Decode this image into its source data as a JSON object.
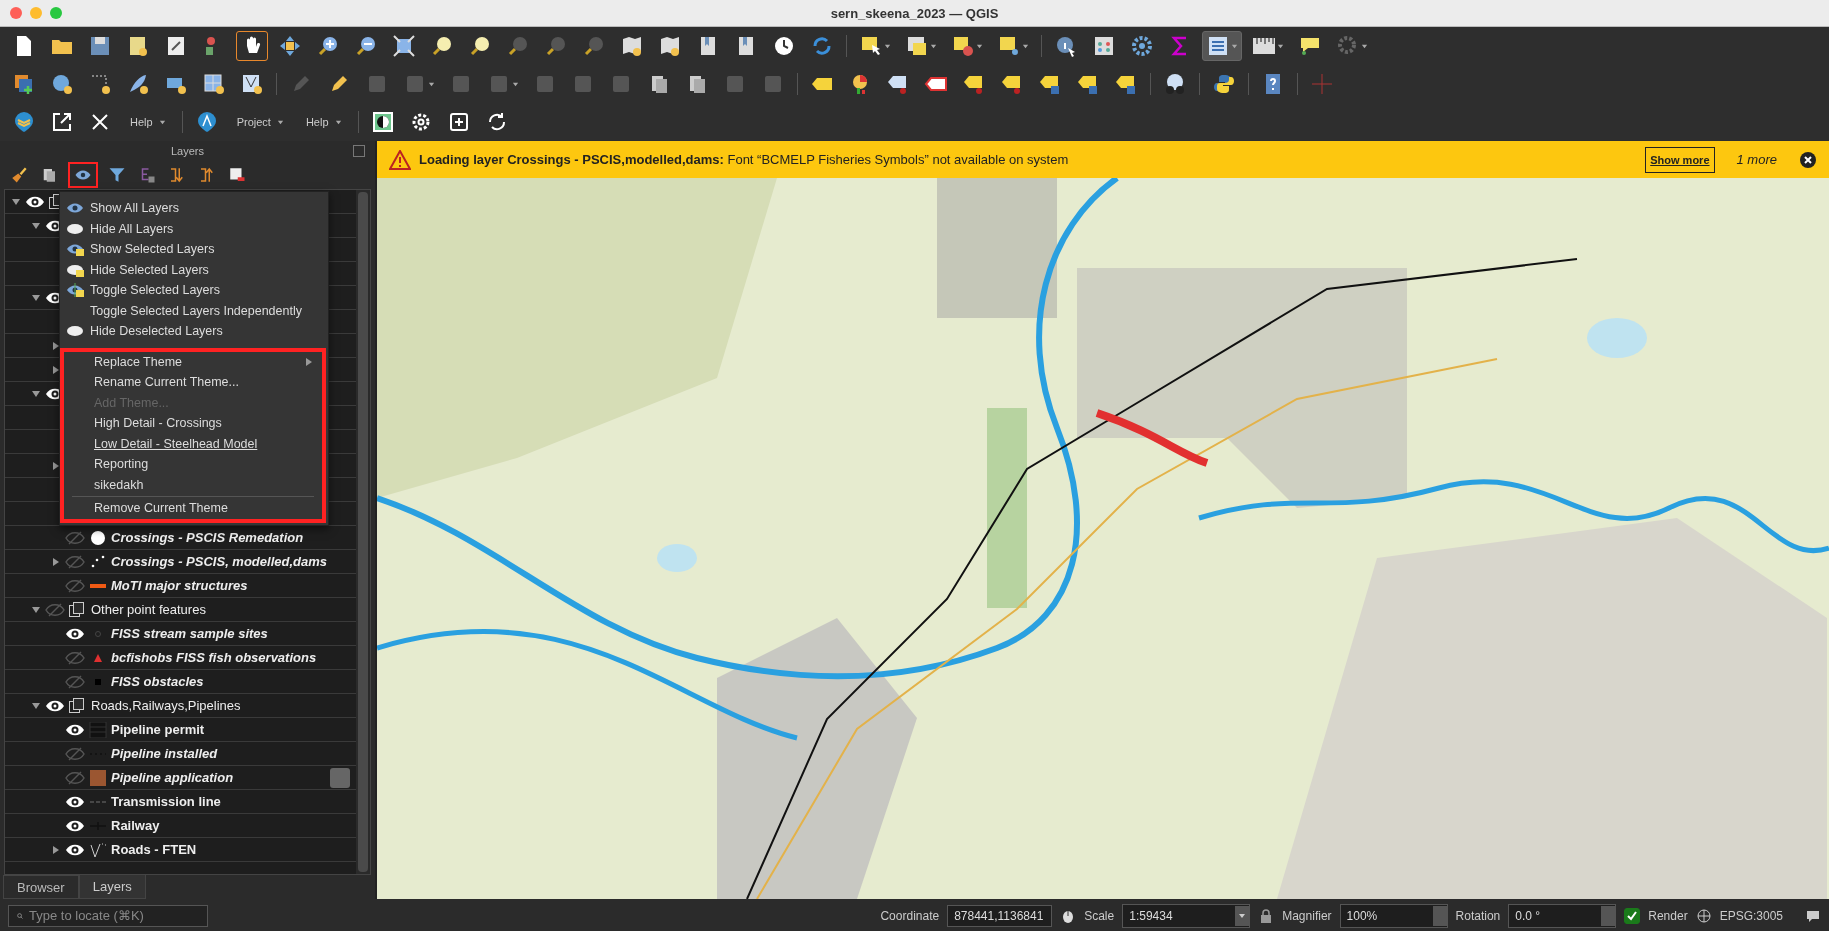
{
  "window": {
    "title": "sern_skeena_2023 — QGIS"
  },
  "toolbar_3": {
    "menus": [
      {
        "label": "Help"
      },
      {
        "label": "Project"
      },
      {
        "label": "Help"
      }
    ]
  },
  "layers_panel": {
    "title": "Layers",
    "visibility_button": {
      "highlighted": true
    },
    "tree": [
      {
        "kind": "group",
        "visible": true,
        "expanded": true,
        "children": [
          {
            "kind": "group",
            "visible": true,
            "expanded": true,
            "children": [
              {
                "kind": "layer"
              },
              {
                "kind": "layer"
              }
            ]
          },
          {
            "kind": "group",
            "visible": true,
            "expanded": true,
            "children": [
              {
                "kind": "layer"
              },
              {
                "kind": "layer",
                "expanded": false
              },
              {
                "kind": "layer",
                "expanded": false
              }
            ]
          },
          {
            "kind": "group",
            "visible": true,
            "expanded": true,
            "children": [
              {
                "kind": "layer"
              },
              {
                "kind": "layer"
              },
              {
                "kind": "layer",
                "expanded": false
              },
              {
                "kind": "layer"
              },
              {
                "kind": "layer"
              },
              {
                "kind": "layer",
                "label": "Crossings - PSCIS Remedation",
                "visible": false,
                "italic": true,
                "symbol": {
                  "kind": "circle"
                }
              },
              {
                "kind": "layer",
                "label": "Crossings - PSCIS, modelled,dams",
                "visible": false,
                "italic": true,
                "symbol": {
                  "kind": "points"
                },
                "expanded": false
              },
              {
                "kind": "layer",
                "label": "MoTI major structures",
                "visible": false,
                "italic": true,
                "symbol": {
                  "kind": "orange-line"
                }
              }
            ]
          },
          {
            "kind": "group",
            "label": "Other point features",
            "visible": false,
            "expanded": true,
            "children": [
              {
                "kind": "layer",
                "label": "FISS stream sample sites",
                "visible": true,
                "italic": true,
                "symbol": {
                  "kind": "ring"
                }
              },
              {
                "kind": "layer",
                "label": "bcfishobs FISS fish observations",
                "visible": false,
                "italic": true,
                "symbol": {
                  "kind": "triangle"
                }
              },
              {
                "kind": "layer",
                "label": "FISS obstacles",
                "visible": false,
                "italic": true,
                "symbol": {
                  "kind": "square"
                }
              }
            ]
          },
          {
            "kind": "group",
            "label": "Roads,Railways,Pipelines",
            "visible": true,
            "expanded": true,
            "children": [
              {
                "kind": "layer",
                "label": "Pipeline permit",
                "visible": true,
                "italic": false,
                "symbol": {
                  "kind": "hatch"
                }
              },
              {
                "kind": "layer",
                "label": "Pipeline installed",
                "visible": false,
                "italic": true,
                "symbol": {
                  "kind": "dots"
                }
              },
              {
                "kind": "layer",
                "label": "Pipeline application",
                "visible": false,
                "italic": true,
                "symbol": {
                  "kind": "brown-fill"
                },
                "indicator": true
              },
              {
                "kind": "layer",
                "label": "Transmission line",
                "visible": true,
                "italic": false,
                "symbol": {
                  "kind": "dashed"
                }
              },
              {
                "kind": "layer",
                "label": "Railway",
                "visible": true,
                "italic": false,
                "symbol": {
                  "kind": "rail"
                }
              },
              {
                "kind": "layer",
                "label": "Roads - FTEN",
                "visible": true,
                "italic": false,
                "symbol": {
                  "kind": "roads"
                },
                "expanded": false
              }
            ]
          }
        ]
      }
    ],
    "tabs": [
      {
        "label": "Browser",
        "selected": false
      },
      {
        "label": "Layers",
        "selected": true
      }
    ]
  },
  "visibility_menu": {
    "sections": [
      {
        "highlighted": false,
        "items": [
          {
            "kind": "eye",
            "label": "Show All Layers",
            "disabled": false,
            "submenu": false,
            "underlined": false
          },
          {
            "kind": "cloud",
            "label": "Hide All Layers",
            "disabled": false,
            "submenu": false,
            "underlined": false
          },
          {
            "kind": "eye-selected",
            "label": "Show Selected Layers",
            "disabled": false,
            "submenu": false,
            "underlined": false
          },
          {
            "kind": "cloud-selected",
            "label": "Hide Selected Layers",
            "disabled": false,
            "submenu": false,
            "underlined": false
          },
          {
            "kind": "toggle",
            "label": "Toggle Selected Layers",
            "disabled": false,
            "submenu": false,
            "underlined": false
          },
          {
            "kind": "plain",
            "label": "Toggle Selected Layers Independently",
            "disabled": false,
            "submenu": false,
            "underlined": false
          },
          {
            "kind": "cloud",
            "label": "Hide Deselected Layers",
            "disabled": false,
            "submenu": false,
            "underlined": false
          }
        ]
      },
      {
        "highlighted": true,
        "items": [
          {
            "kind": "plain",
            "label": "Replace Theme",
            "disabled": false,
            "submenu": true,
            "underlined": false
          },
          {
            "kind": "plain",
            "label": "Rename Current Theme...",
            "disabled": false,
            "submenu": false,
            "underlined": false
          },
          {
            "kind": "plain",
            "label": "Add Theme...",
            "disabled": true,
            "submenu": false,
            "underlined": false
          },
          {
            "kind": "plain",
            "label": "High Detail - Crossings",
            "disabled": false,
            "submenu": false,
            "underlined": false
          },
          {
            "kind": "plain",
            "label": "Low Detail - Steelhead Model",
            "disabled": false,
            "submenu": false,
            "underlined": true
          },
          {
            "kind": "plain",
            "label": "Reporting",
            "disabled": false,
            "submenu": false,
            "underlined": false
          },
          {
            "kind": "plain",
            "label": "sikedakh",
            "disabled": false,
            "submenu": false,
            "underlined": false
          },
          {
            "kind": "separator"
          },
          {
            "kind": "plain",
            "label": "Remove Current Theme",
            "disabled": false,
            "submenu": false,
            "underlined": false
          }
        ]
      }
    ]
  },
  "message_bar": {
    "text": "**Loading layer Crossings - PSCIS,modelled,dams:** Font “BCMELP Fisheries Symbols” not available on system",
    "button": "Show more",
    "more": "1 more"
  },
  "status_bar": {
    "locator": {
      "placeholder": "Type to locate (⌘K)"
    },
    "coordinate": {
      "label": "Coordinate",
      "value": "878441,1136841"
    },
    "scale": {
      "label": "Scale",
      "value": "1:59434"
    },
    "magnifier": {
      "label": "Magnifier",
      "value": "100%"
    },
    "rotation": {
      "label": "Rotation",
      "value": "0.0 °"
    },
    "render": {
      "label": "Render",
      "checked": true
    },
    "crs": "EPSG:3005"
  }
}
